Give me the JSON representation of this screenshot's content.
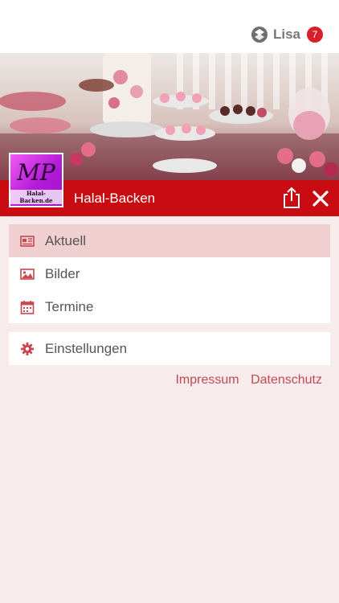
{
  "user": {
    "name": "Lisa",
    "notification_count": "7",
    "icon": "user-network-icon"
  },
  "hero": {
    "icon": "dessert-table-photo"
  },
  "logo": {
    "mark": "MP",
    "text": "Halal-Backen.de"
  },
  "appbar": {
    "title": "Halal-Backen",
    "share_icon": "share-icon",
    "close_icon": "close-icon",
    "background": "#c80c12"
  },
  "menu": {
    "items": [
      {
        "label": "Aktuell",
        "icon": "newspaper-icon",
        "active": true
      },
      {
        "label": "Bilder",
        "icon": "image-icon",
        "active": false
      },
      {
        "label": "Termine",
        "icon": "calendar-icon",
        "active": false
      }
    ],
    "settings": {
      "label": "Einstellungen",
      "icon": "gear-icon"
    }
  },
  "footer": {
    "impressum": "Impressum",
    "datenschutz": "Datenschutz"
  },
  "colors": {
    "accent": "#c80c12",
    "page_background": "#f8ebeb",
    "active_item": "#f0cfd0",
    "link": "#c04a55"
  }
}
